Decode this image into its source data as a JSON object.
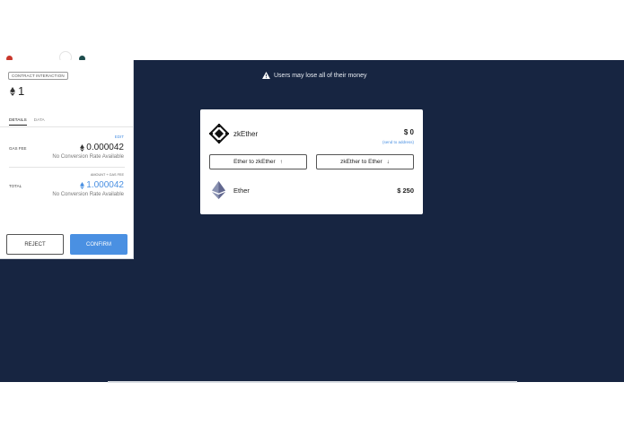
{
  "warning": {
    "text": "Users may lose all of their money"
  },
  "wallet_card": {
    "zk_token": {
      "name": "zkEther",
      "amount": "$ 0",
      "send_link": "(send to address)"
    },
    "buttons": {
      "deposit": "Ether to zkEther",
      "withdraw": "zkEther to Ether",
      "deposit_arrow": "↑",
      "withdraw_arrow": "↓"
    },
    "eth_token": {
      "name": "Ether",
      "amount": "$ 250"
    }
  },
  "metamask": {
    "tag": "CONTRACT INTERACTION",
    "value": "1",
    "tabs": {
      "details": "DETAILS",
      "data": "DATA"
    },
    "edit": "EDIT",
    "gas_fee": {
      "label": "GAS FEE",
      "value": "0.000042",
      "note": "No Conversion Rate Available"
    },
    "amount_gas_label": "AMOUNT + GAS FEE",
    "total": {
      "label": "TOTAL",
      "value": "1.000042",
      "note": "No Conversion Rate Available"
    },
    "reject": "REJECT",
    "confirm": "CONFIRM"
  },
  "colors": {
    "background": "#172541",
    "accent": "#4a90e2",
    "card": "#ffffff"
  },
  "icons": [
    "warning-icon",
    "zkether-logo-icon",
    "ether-icon",
    "eth-diamond-icon",
    "arrow-up-icon",
    "arrow-down-icon"
  ]
}
